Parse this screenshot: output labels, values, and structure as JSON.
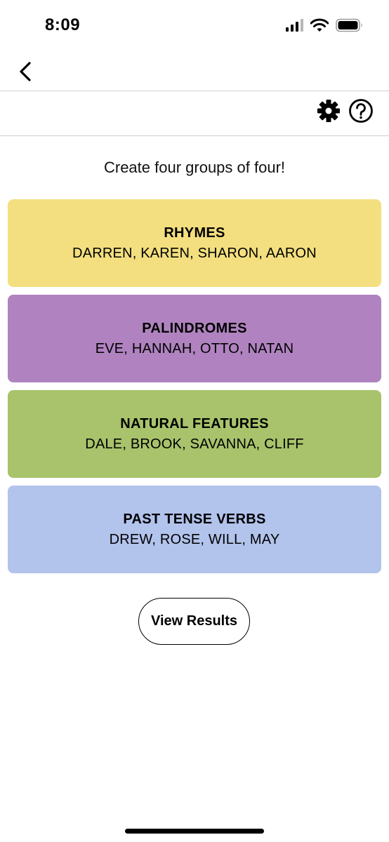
{
  "status_bar": {
    "time": "8:09"
  },
  "instructions": "Create four groups of four!",
  "groups": [
    {
      "title": "RHYMES",
      "members": "DARREN, KAREN, SHARON, AARON",
      "color": "#f3df7f"
    },
    {
      "title": "PALINDROMES",
      "members": "EVE, HANNAH, OTTO, NATAN",
      "color": "#b083c0"
    },
    {
      "title": "NATURAL FEATURES",
      "members": "DALE, BROOK, SAVANNA, CLIFF",
      "color": "#a8c36b"
    },
    {
      "title": "PAST TENSE VERBS",
      "members": "DREW, ROSE, WILL, MAY",
      "color": "#b2c3ec"
    }
  ],
  "actions": {
    "view_results_label": "View Results"
  },
  "icons": {
    "back": "chevron-left-icon",
    "settings": "gear-icon",
    "help": "question-circle-icon"
  }
}
